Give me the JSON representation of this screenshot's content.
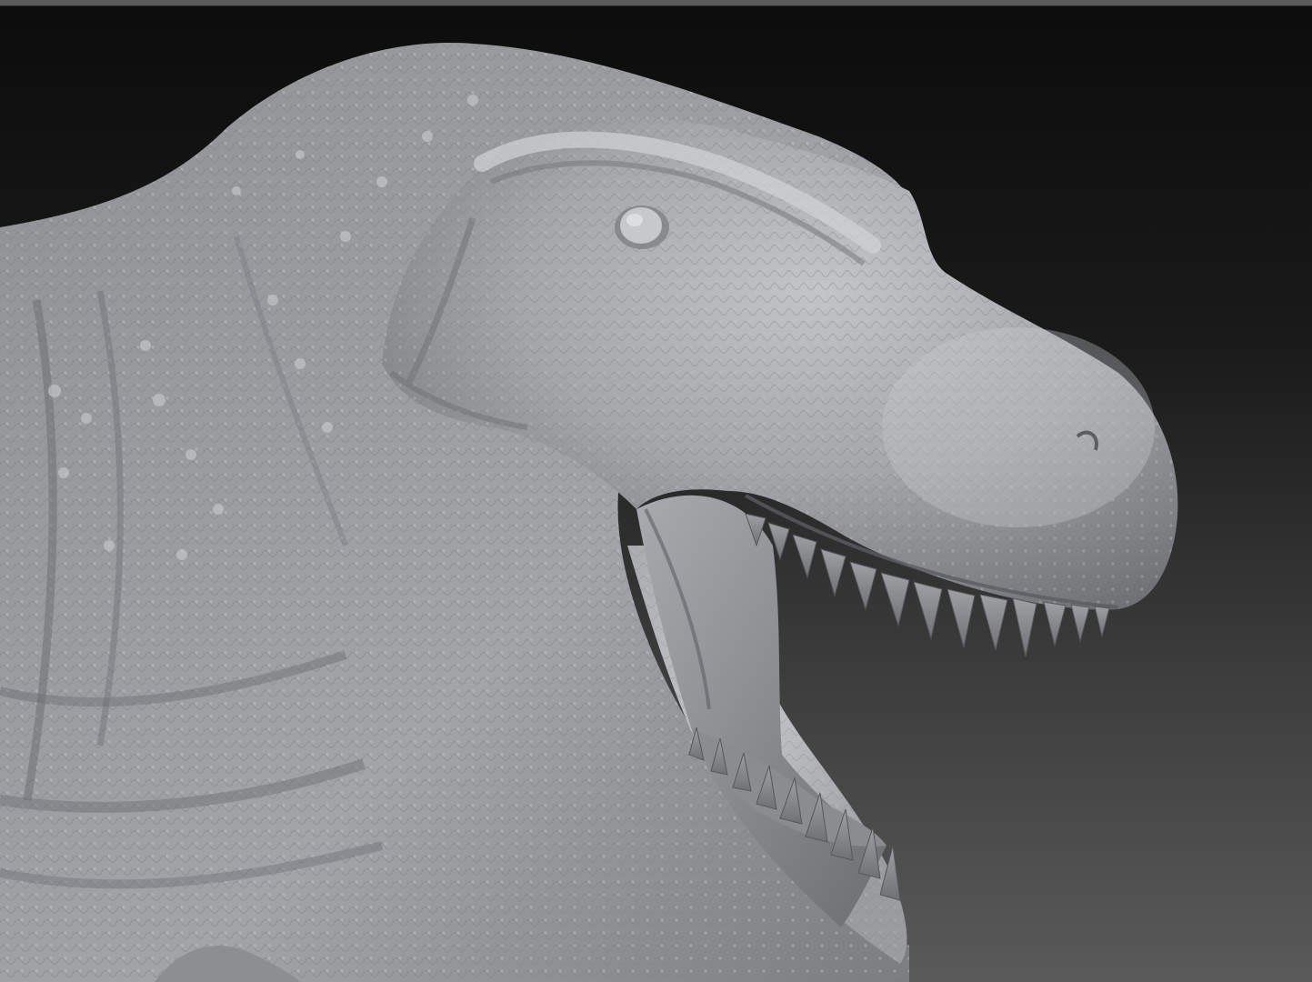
{
  "scene": {
    "subject": "sculpted-trex-head",
    "render_style": "matcap-clay",
    "colors": {
      "background_top": "#0c0c0c",
      "background_bottom": "#5a5a5a",
      "clay_light": "#b4b6b9",
      "clay_mid": "#8e9094",
      "clay_dark": "#5d5f63",
      "mouth_interior": "#7d7f83"
    }
  }
}
